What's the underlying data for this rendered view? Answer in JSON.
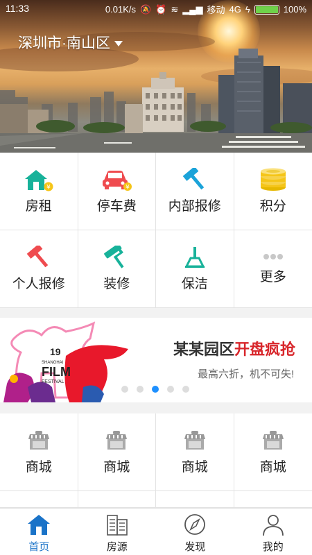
{
  "status": {
    "time": "11:33",
    "speed": "0.01K/s",
    "carrier": "移动",
    "network": "4G",
    "battery": "100%",
    "battery_level": 1.0
  },
  "header": {
    "city": "深圳市·南山区"
  },
  "services": [
    {
      "label": "房租",
      "icon": "house-rent-icon"
    },
    {
      "label": "停车费",
      "icon": "car-fee-icon"
    },
    {
      "label": "内部报修",
      "icon": "hammer-icon"
    },
    {
      "label": "积分",
      "icon": "coins-icon"
    },
    {
      "label": "个人报修",
      "icon": "hammer-icon"
    },
    {
      "label": "装修",
      "icon": "paint-roller-icon"
    },
    {
      "label": "保洁",
      "icon": "cleaning-icon"
    },
    {
      "label": "更多",
      "icon": "more-dots-icon"
    }
  ],
  "promo": {
    "headline_plain": "某某园区",
    "headline_hot": "开盘疯抢",
    "subtext": "最高六折，机不可失!",
    "poster_text": "19th SHANGHAI INTERNATIONAL FILM FESTIVAL",
    "poster_number": "19",
    "poster_film": "FILM",
    "poster_festival": "FESTIVAL",
    "poster_shanghai": "SHANGHAI",
    "active_dot": 2,
    "dot_count": 5
  },
  "shops": [
    {
      "label": "商城"
    },
    {
      "label": "商城"
    },
    {
      "label": "商城"
    },
    {
      "label": "商城"
    }
  ],
  "tabs": [
    {
      "label": "首页",
      "icon": "home-icon",
      "active": true
    },
    {
      "label": "房源",
      "icon": "building-icon",
      "active": false
    },
    {
      "label": "发现",
      "icon": "compass-icon",
      "active": false
    },
    {
      "label": "我的",
      "icon": "person-icon",
      "active": false
    }
  ],
  "colors": {
    "accent_blue": "#1a73c8",
    "service_green": "#18b29a",
    "service_red": "#ef4b4f",
    "coin_yellow": "#f5c518",
    "promo_red": "#d8262b"
  }
}
